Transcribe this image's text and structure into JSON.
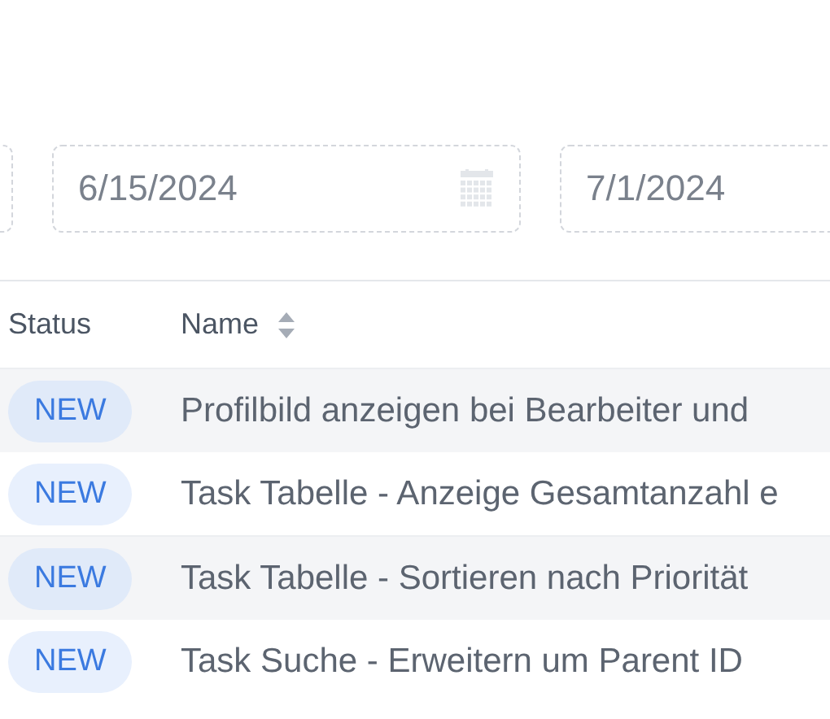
{
  "filters": [
    {
      "value": "6/15/2024",
      "calendar_icon": true
    },
    {
      "value": "7/1/2024"
    }
  ],
  "table": {
    "columns": [
      {
        "label": "Status",
        "sortable": false
      },
      {
        "label": "Name",
        "sortable": true
      }
    ],
    "rows": [
      {
        "status": "NEW",
        "name": "Profilbild anzeigen bei Bearbeiter und"
      },
      {
        "status": "NEW",
        "name": "Task Tabelle - Anzeige Gesamtanzahl e"
      },
      {
        "status": "NEW",
        "name": "Task Tabelle - Sortieren nach Priorität"
      },
      {
        "status": "NEW",
        "name": "Task Suche - Erweitern um Parent ID"
      }
    ]
  }
}
